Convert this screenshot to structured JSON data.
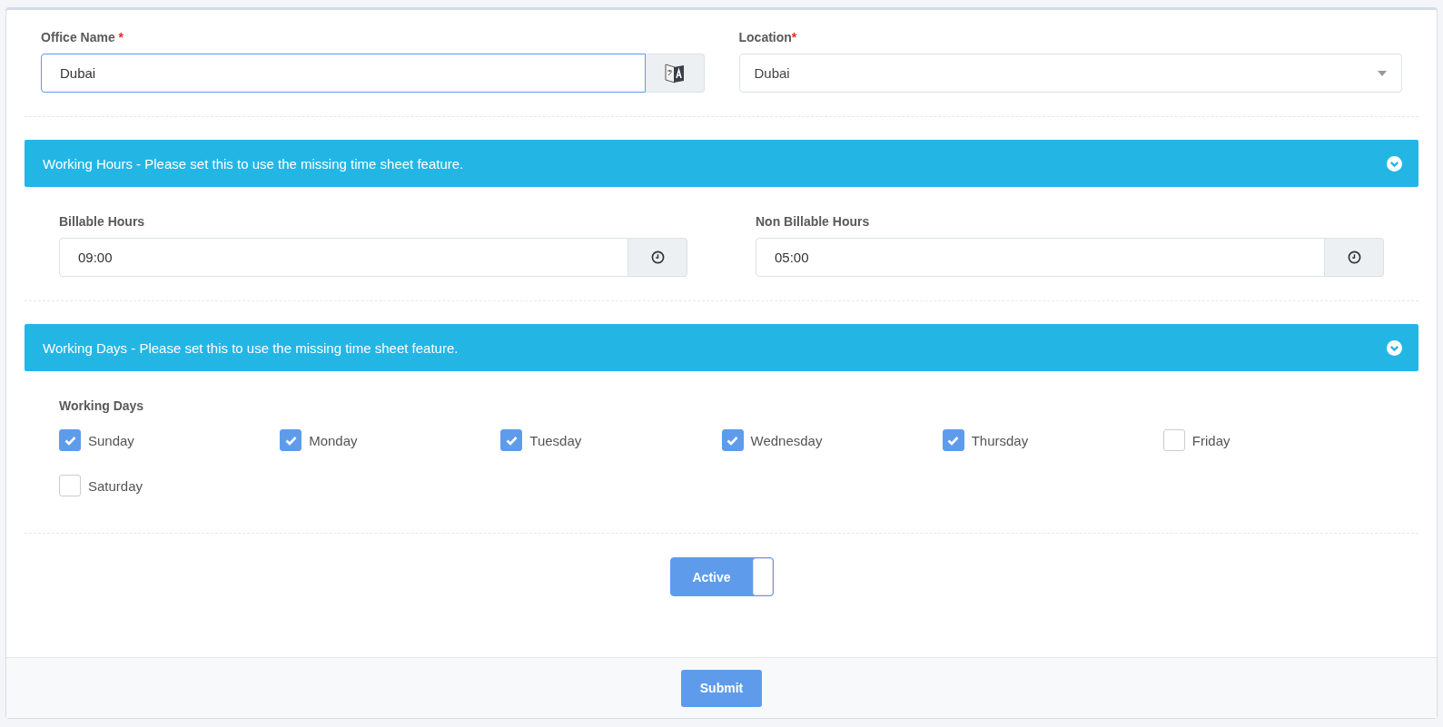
{
  "office_name": {
    "label": "Office Name",
    "required": "*",
    "value": "Dubai"
  },
  "location": {
    "label": "Location",
    "required": "*",
    "value": "Dubai"
  },
  "working_hours": {
    "title": "Working Hours - Please set this to use the missing time sheet feature.",
    "expanded": true,
    "fields": [
      {
        "label": "Billable Hours",
        "value": "09:00"
      },
      {
        "label": "Non Billable Hours",
        "value": "05:00"
      }
    ]
  },
  "working_days": {
    "title": "Working Days - Please set this to use the missing time sheet feature.",
    "expanded": true,
    "label": "Working Days",
    "days": [
      {
        "label": "Sunday",
        "checked": true
      },
      {
        "label": "Monday",
        "checked": true
      },
      {
        "label": "Tuesday",
        "checked": true
      },
      {
        "label": "Wednesday",
        "checked": true
      },
      {
        "label": "Thursday",
        "checked": true
      },
      {
        "label": "Friday",
        "checked": false
      },
      {
        "label": "Saturday",
        "checked": false
      }
    ]
  },
  "active_toggle": {
    "label": "Active",
    "on": true
  },
  "submit": "Submit"
}
